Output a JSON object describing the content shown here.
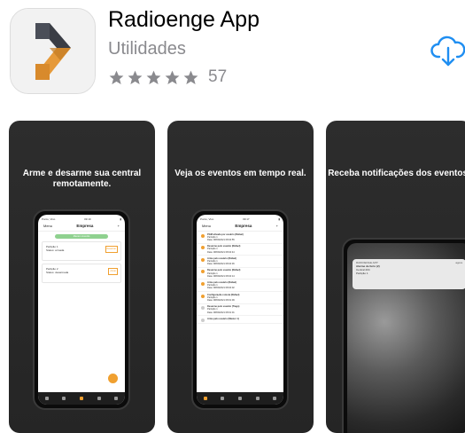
{
  "app": {
    "title": "Radioenge App",
    "category": "Utilidades",
    "rating_count": "57",
    "stars": 5,
    "icon_colors": {
      "top": "#3a3d45",
      "bottom": "#e69a3a",
      "background": "#f2f2f2"
    },
    "download_icon": "cloud-download-icon",
    "accent": "#1f8ef1"
  },
  "screenshots": [
    {
      "caption": "Arme e desarme sua central remotamente.",
      "screen": {
        "status_left": "Ponto, Vivo",
        "status_time": "09:19",
        "nav_left": "Menu",
        "nav_title": "Empresa",
        "nav_right": "+",
        "pill": "Manter conexão",
        "cards": [
          {
            "title": "Partição 1",
            "status": "Status: armada",
            "button": "Desarmar"
          },
          {
            "title": "Partição 2",
            "status": "Status: desarmada",
            "button": "Armar"
          }
        ]
      }
    },
    {
      "caption": "Veja os eventos em tempo real.",
      "screen": {
        "status_left": "Ponto, Vivo",
        "status_time": "09:17",
        "nav_left": "Menu",
        "nav_title": "Empresa",
        "nav_right": "+",
        "events": [
          {
            "title": "PGM ativada por usuário (Rafael)",
            "detail": "Partição 1",
            "date": "Data: 08/09/2021 08:04:55"
          },
          {
            "title": "Desarme pelo usuário (Rafael)",
            "detail": "Partição 1",
            "date": "Data: 08/09/2021 08:04:44"
          },
          {
            "title": "Arme pelo usuário (Rafael)",
            "detail": "Partição 1",
            "date": "Data: 08/09/2021 08:04:36"
          },
          {
            "title": "Desarme pelo usuário (Rafael)",
            "detail": "Partição 1",
            "date": "Data: 08/09/2021 08:04:14"
          },
          {
            "title": "Arme pelo usuário (Rafael)",
            "detail": "Partição 1",
            "date": "Data: 08/09/2021 08:04:02"
          },
          {
            "title": "Configuração remota (Rafael)",
            "detail": "Partição 1",
            "date": "Data: 08/09/2021 08:01:09"
          },
          {
            "title": "Desarme pelo usuário (Tiago)",
            "detail": "Partição 1",
            "date": "Data: 08/09/2021 08:01:01"
          },
          {
            "title": "Arme pelo usuário (Master 1)",
            "detail": "",
            "date": ""
          }
        ]
      }
    },
    {
      "caption": "Receba notificações dos eventos.",
      "screen": {
        "notif_app": "RADIOENGE APP",
        "notif_time": "agora",
        "notif_title": "Alarme de furto (2)",
        "notif_line2": "Central 204",
        "notif_line3": "Partição 1"
      }
    }
  ]
}
